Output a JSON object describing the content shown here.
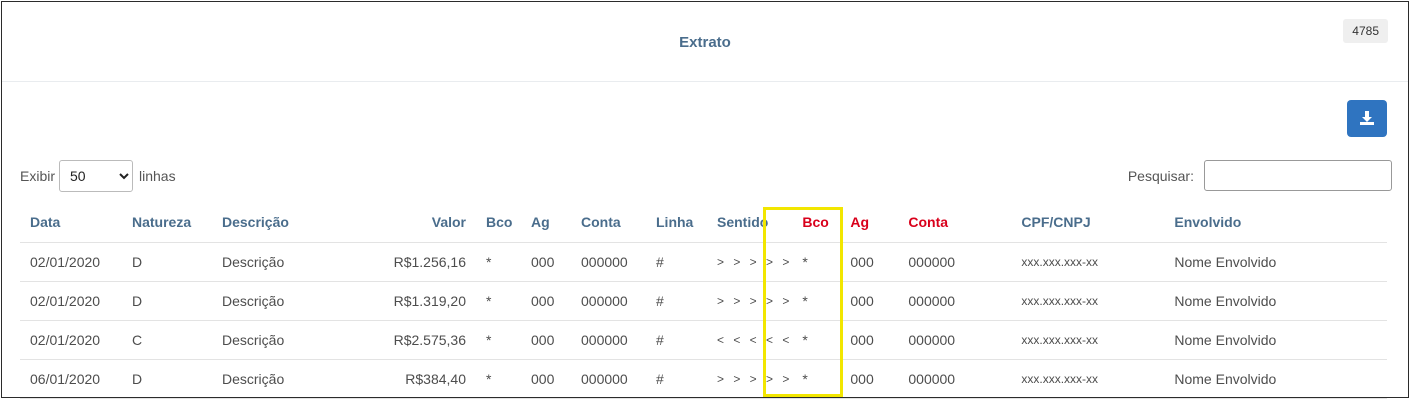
{
  "header": {
    "title": "Extrato",
    "badge": "4785"
  },
  "toolbar": {
    "download_icon": "download-icon"
  },
  "length_control": {
    "prefix": "Exibir",
    "selected": "50",
    "suffix": "linhas"
  },
  "search": {
    "label": "Pesquisar:",
    "value": "",
    "placeholder": ""
  },
  "table": {
    "columns": [
      "Data",
      "Natureza",
      "Descrição",
      "Valor",
      "Bco",
      "Ag",
      "Conta",
      "Linha",
      "Sentido",
      "Bco",
      "Ag",
      "Conta",
      "CPF/CNPJ",
      "Envolvido"
    ],
    "rows": [
      [
        "02/01/2020",
        "D",
        "Descrição",
        "R$1.256,16",
        "*",
        "000",
        "000000",
        "#",
        "> > > > >",
        "*",
        "000",
        "000000",
        "xxx.xxx.xxx-xx",
        "Nome Envolvido"
      ],
      [
        "02/01/2020",
        "D",
        "Descrição",
        "R$1.319,20",
        "*",
        "000",
        "000000",
        "#",
        "> > > > >",
        "*",
        "000",
        "000000",
        "xxx.xxx.xxx-xx",
        "Nome Envolvido"
      ],
      [
        "02/01/2020",
        "C",
        "Descrição",
        "R$2.575,36",
        "*",
        "000",
        "000000",
        "#",
        "< < < < <",
        "*",
        "000",
        "000000",
        "xxx.xxx.xxx-xx",
        "Nome Envolvido"
      ],
      [
        "06/01/2020",
        "D",
        "Descrição",
        "R$384,40",
        "*",
        "000",
        "000000",
        "#",
        "> > > > >",
        "*",
        "000",
        "000000",
        "xxx.xxx.xxx-xx",
        "Nome Envolvido"
      ]
    ]
  },
  "colors": {
    "header_text": "#4a6d8c",
    "counterparty_header": "#d9001b",
    "button": "#2f74c0",
    "highlight": "#f2e600"
  }
}
